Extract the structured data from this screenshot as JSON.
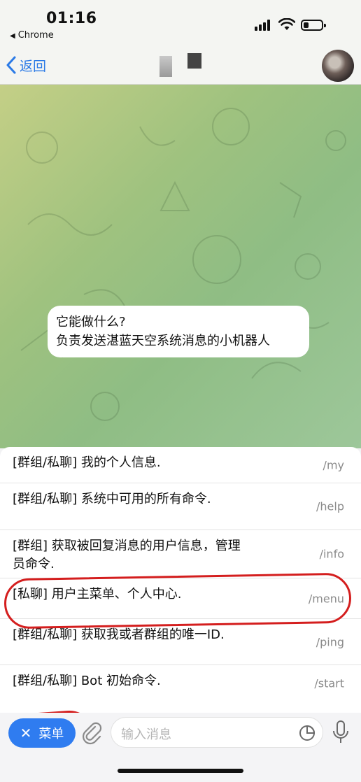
{
  "status_bar": {
    "time": "01:16",
    "back_app": "Chrome"
  },
  "nav": {
    "back_label": "返回",
    "avatar": "avatar"
  },
  "chat": {
    "bubble_line1": "它能做什么?",
    "bubble_line2": "负责发送湛蓝天空系统消息的小机器人"
  },
  "commands": [
    {
      "desc": "[群组/私聊] 我的个人信息.",
      "code": "/my"
    },
    {
      "desc": "[群组/私聊] 系统中可用的所有命令.",
      "code": "/help"
    },
    {
      "desc": "[群组]  获取被回复消息的用户信息，管理员命令.",
      "code": "/info"
    },
    {
      "desc": "[私聊]  用户主菜单、个人中心.",
      "code": "/menu"
    },
    {
      "desc": "[群组/私聊] 获取我或者群组的唯一ID.",
      "code": "/ping"
    },
    {
      "desc": "[群组/私聊] Bot 初始命令.",
      "code": "/start"
    }
  ],
  "input_bar": {
    "menu_label": "菜单",
    "placeholder": "输入消息"
  },
  "colors": {
    "accent": "#2f7cf0",
    "link": "#2b7ae6",
    "annotation": "#d41e1e"
  },
  "icons": [
    "signal-icon",
    "wifi-icon",
    "battery-icon",
    "chevron-left-icon",
    "close-icon",
    "paperclip-icon",
    "sticker-icon",
    "microphone-icon"
  ]
}
